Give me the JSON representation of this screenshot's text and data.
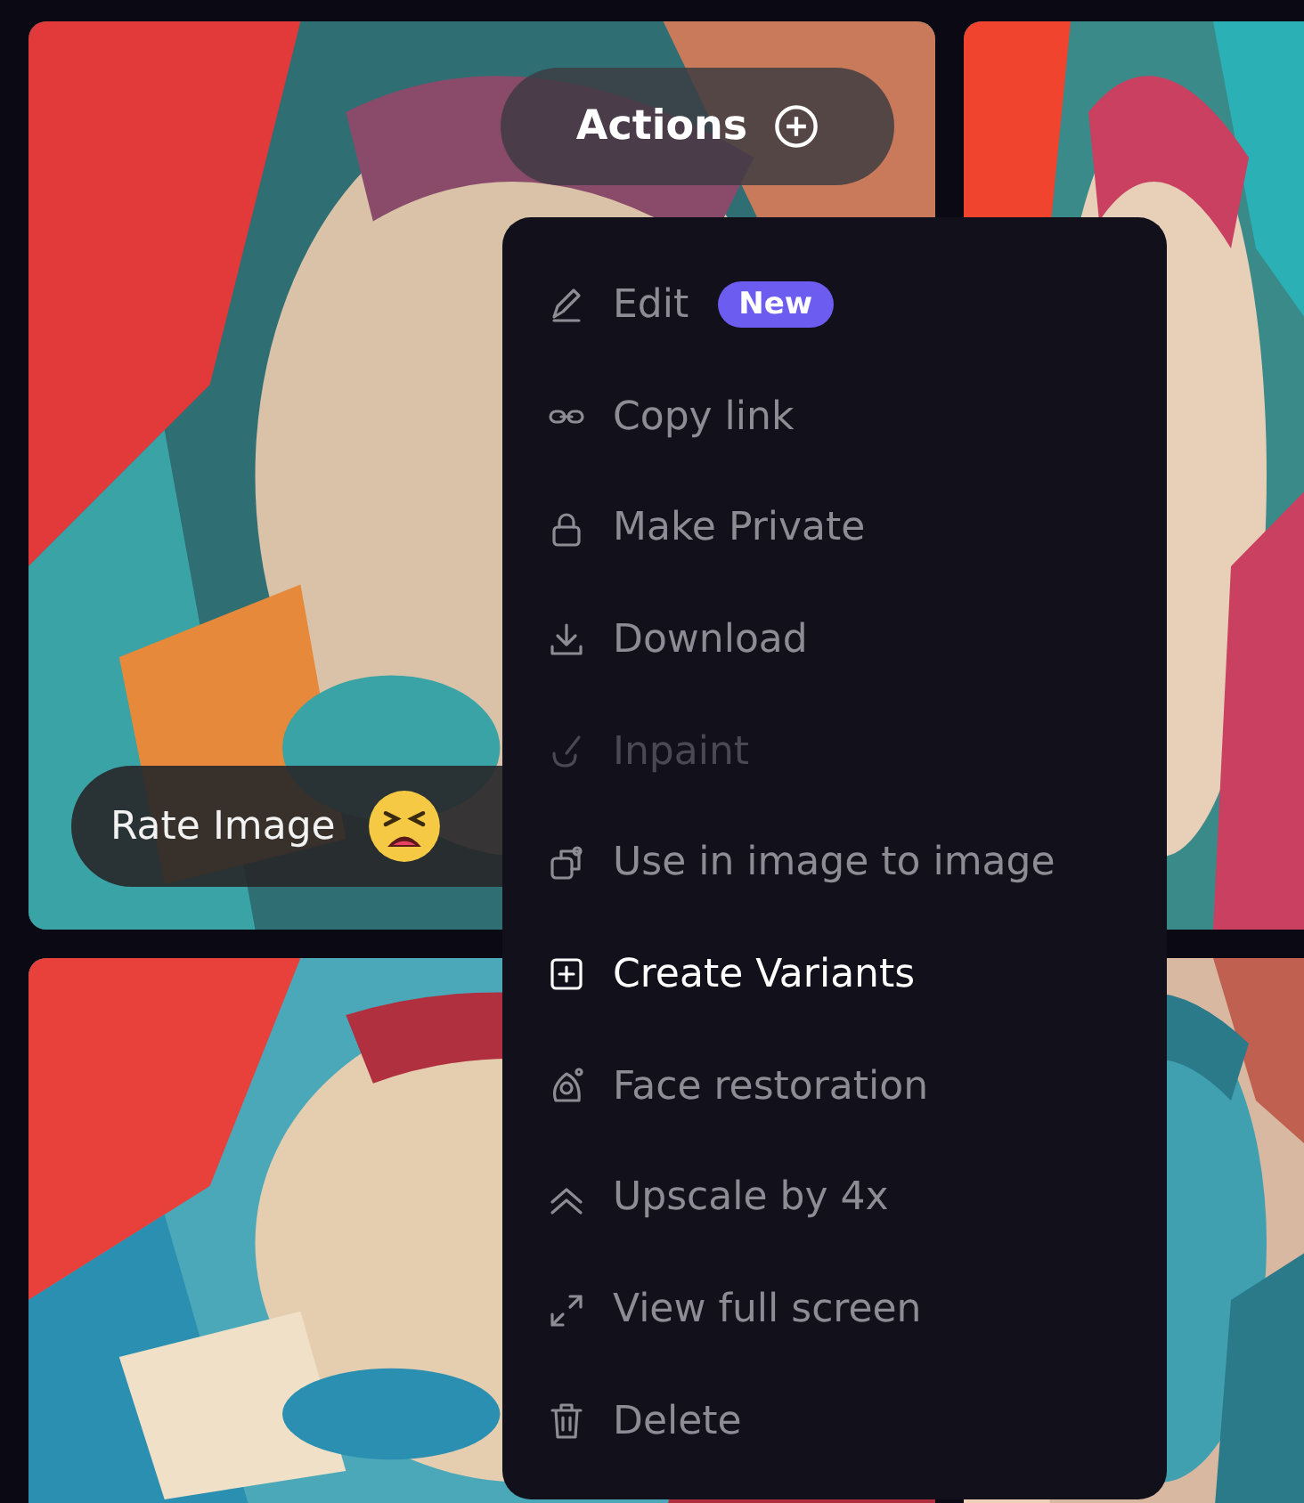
{
  "actions_button": {
    "label": "Actions"
  },
  "rate_bar": {
    "label": "Rate Image"
  },
  "menu": {
    "items": [
      {
        "label": "Edit",
        "badge": "New",
        "disabled": false,
        "selected": false
      },
      {
        "label": "Copy link",
        "disabled": false,
        "selected": false
      },
      {
        "label": "Make Private",
        "disabled": false,
        "selected": false
      },
      {
        "label": "Download",
        "disabled": false,
        "selected": false
      },
      {
        "label": "Inpaint",
        "disabled": true,
        "selected": false
      },
      {
        "label": "Use in image to image",
        "disabled": false,
        "selected": false
      },
      {
        "label": "Create Variants",
        "disabled": false,
        "selected": true
      },
      {
        "label": "Face restoration",
        "disabled": false,
        "selected": false
      },
      {
        "label": "Upscale by 4x",
        "disabled": false,
        "selected": false
      },
      {
        "label": "View full screen",
        "disabled": false,
        "selected": false
      },
      {
        "label": "Delete",
        "disabled": false,
        "selected": false
      }
    ]
  }
}
